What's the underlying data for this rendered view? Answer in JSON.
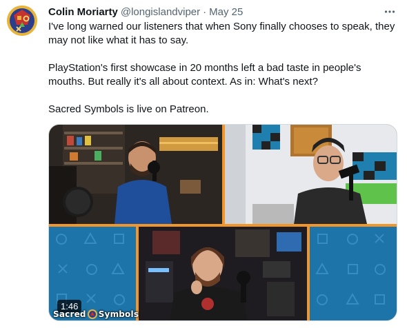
{
  "tweet": {
    "author_name": "Colin Moriarty",
    "handle": "@longislandviper",
    "separator": "·",
    "date": "May 25",
    "paragraphs": [
      "I've long warned our listeners that when Sony finally chooses to speak, they may not like what it has to say.",
      "PlayStation's first showcase in 20 months left a bad taste in people's mouths. But really it's all about context. As in: What's next?",
      "Sacred Symbols is live on Patreon."
    ]
  },
  "media": {
    "duration": "1:46",
    "brand_left": "Sacred",
    "brand_right": "Symbols"
  },
  "icons": {
    "more": "more-options-icon",
    "avatar": "podcast-logo-avatar",
    "brand": "sacred-symbols-logo-icon"
  },
  "colors": {
    "name_text": "#0f1419",
    "secondary_text": "#536471",
    "frame_accent": "#f0962a",
    "ps_blue": "#1e78a8"
  }
}
